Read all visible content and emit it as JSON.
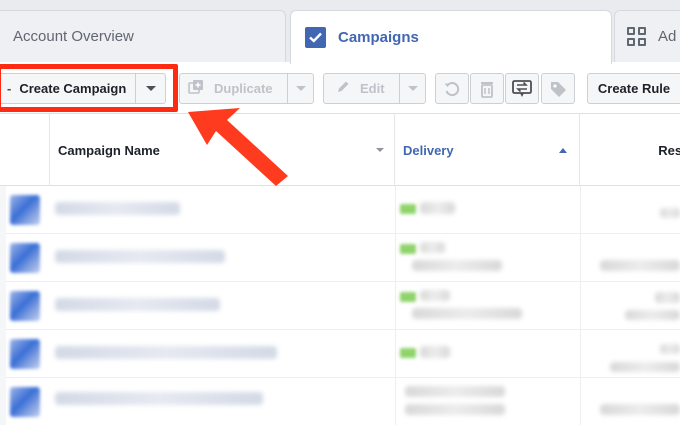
{
  "tabs": [
    {
      "label": "Account Overview"
    },
    {
      "label": "Campaigns"
    },
    {
      "label": "Ad"
    }
  ],
  "toolbar": {
    "create_label": "Create Campaign",
    "duplicate_label": "Duplicate",
    "edit_label": "Edit",
    "create_rule_label": "Create Rule"
  },
  "table": {
    "columns": [
      {
        "label": "Campaign Name"
      },
      {
        "label": "Delivery"
      },
      {
        "label": "Resu"
      }
    ]
  },
  "colors": {
    "accent": "#4267b2",
    "highlight": "#ff2a12",
    "delivery_active": "#8fd36b"
  }
}
